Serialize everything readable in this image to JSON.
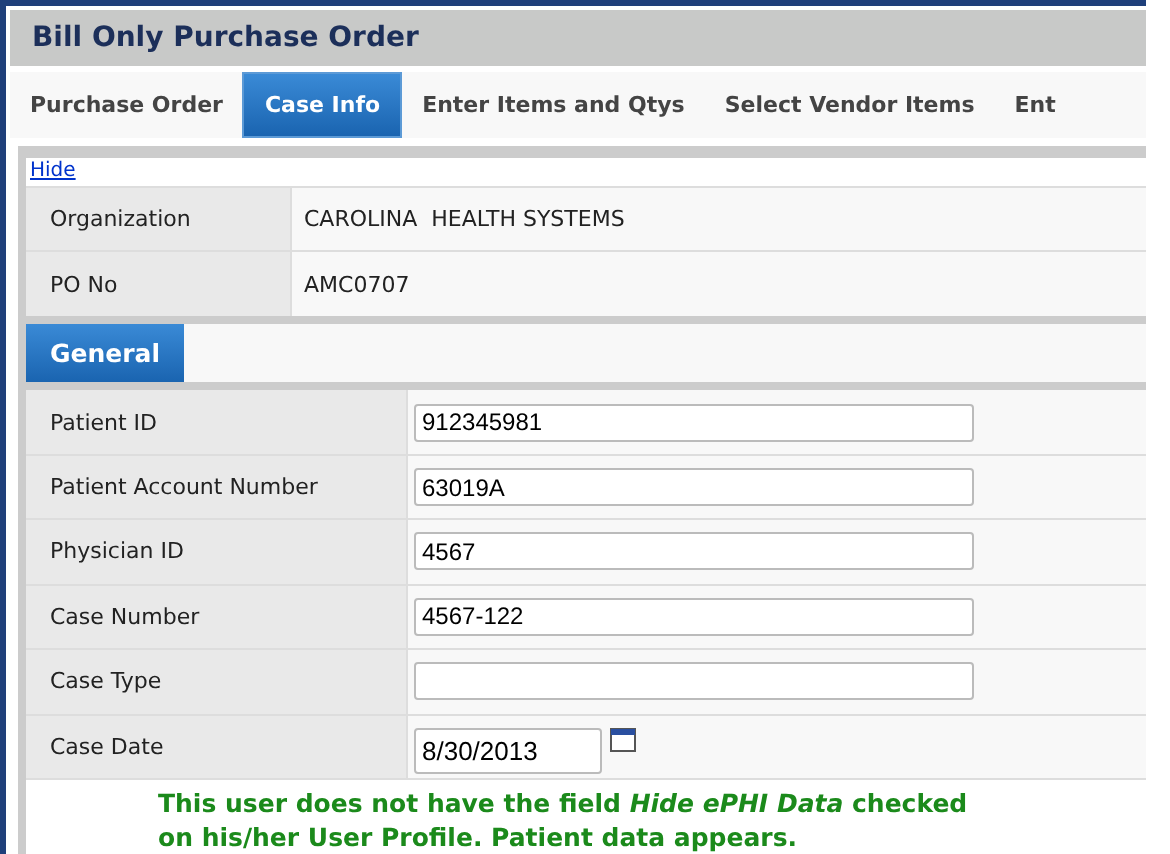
{
  "window": {
    "title": "Bill Only Purchase Order"
  },
  "tabs": [
    {
      "label": "Purchase Order",
      "selected": false
    },
    {
      "label": "Case Info",
      "selected": true
    },
    {
      "label": "Enter Items and Qtys",
      "selected": false
    },
    {
      "label": "Select Vendor Items",
      "selected": false
    },
    {
      "label": "Ent",
      "selected": false
    }
  ],
  "hide_link": "Hide",
  "summary": [
    {
      "label": "Organization",
      "value": "CAROLINA  HEALTH SYSTEMS"
    },
    {
      "label": "PO No",
      "value": "AMC0707"
    }
  ],
  "section_tabs": [
    {
      "label": "General",
      "selected": true
    }
  ],
  "fields": [
    {
      "label": "Patient ID",
      "value": "912345981",
      "kind": "text"
    },
    {
      "label": "Patient Account Number",
      "value": "63019A",
      "kind": "text"
    },
    {
      "label": "Physician ID",
      "value": "4567",
      "kind": "text"
    },
    {
      "label": "Case Number",
      "value": "4567-122",
      "kind": "text"
    },
    {
      "label": "Case Type",
      "kind": "text"
    },
    {
      "label": "Case Date",
      "value": "8/30/2013",
      "kind": "date"
    }
  ],
  "note": "This user does not have the field *Hide ePHI Data* checked on his/her User Profile. Patient data appears."
}
